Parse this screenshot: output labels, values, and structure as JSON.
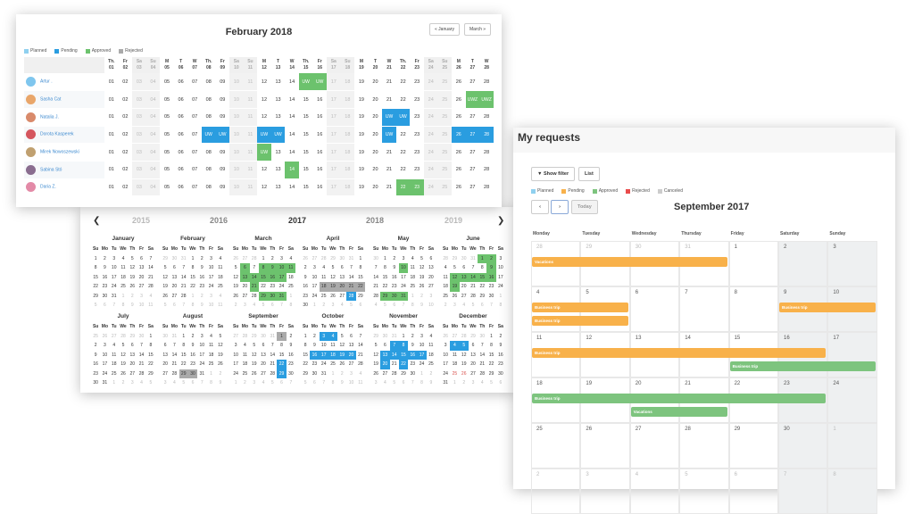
{
  "team": {
    "title": "February 2018",
    "prev": "« January",
    "next": "March »",
    "legend": [
      {
        "label": "Planned",
        "color": "#8fd0ef"
      },
      {
        "label": "Pending",
        "color": "#2a9de0"
      },
      {
        "label": "Approved",
        "color": "#6cc26d"
      },
      {
        "label": "Rejected",
        "color": "#aaaaaa"
      }
    ],
    "days": [
      {
        "d": "Th.",
        "n": "01"
      },
      {
        "d": "Fr",
        "n": "02"
      },
      {
        "d": "Sa",
        "n": "03"
      },
      {
        "d": "Su",
        "n": "04"
      },
      {
        "d": "M",
        "n": "05"
      },
      {
        "d": "T",
        "n": "06"
      },
      {
        "d": "W",
        "n": "07"
      },
      {
        "d": "Th.",
        "n": "08"
      },
      {
        "d": "Fr",
        "n": "09"
      },
      {
        "d": "Sa",
        "n": "10"
      },
      {
        "d": "Su",
        "n": "11"
      },
      {
        "d": "M",
        "n": "12"
      },
      {
        "d": "T",
        "n": "13"
      },
      {
        "d": "W",
        "n": "14"
      },
      {
        "d": "Th.",
        "n": "15"
      },
      {
        "d": "Fr",
        "n": "16"
      },
      {
        "d": "Sa",
        "n": "17"
      },
      {
        "d": "Su",
        "n": "18"
      },
      {
        "d": "M",
        "n": "19"
      },
      {
        "d": "T",
        "n": "20"
      },
      {
        "d": "W",
        "n": "21"
      },
      {
        "d": "Th.",
        "n": "22"
      },
      {
        "d": "Fr",
        "n": "23"
      },
      {
        "d": "Sa",
        "n": "24"
      },
      {
        "d": "Su",
        "n": "25"
      },
      {
        "d": "M",
        "n": "26"
      },
      {
        "d": "T",
        "n": "27"
      },
      {
        "d": "W",
        "n": "28"
      }
    ],
    "employees": [
      {
        "name": "Artur .",
        "avatar": "#7fc6ee",
        "marks": {
          "15": "UW",
          "16": "UW"
        },
        "status": "appr"
      },
      {
        "name": "Sasha Cat",
        "avatar": "#e9a66a",
        "marks": {
          "27": "UWZ",
          "28": "UWZ"
        },
        "status": "appr"
      },
      {
        "name": "Natalia J.",
        "avatar": "#d98a6b",
        "marks": {
          "21": "UW",
          "22": "UW"
        },
        "status": "pend"
      },
      {
        "name": "Dorota Kasperek",
        "avatar": "#d5565e",
        "marks": {
          "08": "UW",
          "09": "UW",
          "12": "UW",
          "13": "UW",
          "21": "UW",
          "26": "26",
          "27": "27",
          "28": "28"
        },
        "status": "pend"
      },
      {
        "name": "Mirek Nowoszewski",
        "avatar": "#c0a070",
        "marks": {
          "12": "UW"
        },
        "status": "appr"
      },
      {
        "name": "Sabina Stó",
        "avatar": "#8a6d8f",
        "marks": {
          "14": "14"
        },
        "status": "appr"
      },
      {
        "name": "Daria Z.",
        "avatar": "#e38aa7",
        "marks": {
          "22": "22",
          "23": "23"
        },
        "status": "appr"
      }
    ]
  },
  "year": {
    "years": [
      "2015",
      "2016",
      "2017",
      "2018",
      "2019"
    ],
    "current": "2017",
    "dow": [
      "Su",
      "Mo",
      "Tu",
      "We",
      "Th",
      "Fr",
      "Sa"
    ],
    "months": [
      {
        "name": "January",
        "first": 0,
        "days": 31,
        "prevdays": 31,
        "marks": {}
      },
      {
        "name": "February",
        "first": 3,
        "days": 28,
        "prevdays": 31,
        "marks": {}
      },
      {
        "name": "March",
        "first": 3,
        "days": 31,
        "prevdays": 28,
        "marks": {
          "6": "g",
          "8": "g",
          "9": "g",
          "10": "g",
          "11": "g",
          "13": "g",
          "14": "g",
          "15": "g",
          "16": "g",
          "17": "g",
          "21": "g",
          "29": "g",
          "30": "g",
          "31": "g"
        }
      },
      {
        "name": "April",
        "first": 6,
        "days": 30,
        "prevdays": 31,
        "marks": {
          "18": "gr",
          "19": "gr",
          "20": "gr",
          "21": "gr",
          "22": "gr",
          "28": "b"
        }
      },
      {
        "name": "May",
        "first": 1,
        "days": 31,
        "prevdays": 30,
        "marks": {
          "10": "g",
          "29": "g",
          "30": "g",
          "31": "g"
        }
      },
      {
        "name": "June",
        "first": 4,
        "days": 30,
        "prevdays": 31,
        "marks": {
          "1": "g",
          "2": "g",
          "9": "g",
          "12": "g",
          "13": "g",
          "14": "g",
          "15": "g",
          "16": "g",
          "19": "g"
        }
      },
      {
        "name": "July",
        "first": 6,
        "days": 31,
        "prevdays": 30,
        "marks": {}
      },
      {
        "name": "August",
        "first": 2,
        "days": 31,
        "prevdays": 31,
        "marks": {
          "29": "gr",
          "30": "gr"
        }
      },
      {
        "name": "September",
        "first": 5,
        "days": 30,
        "prevdays": 31,
        "marks": {
          "1": "gr",
          "22": "b",
          "29": "b"
        }
      },
      {
        "name": "October",
        "first": 0,
        "days": 31,
        "prevdays": 30,
        "marks": {
          "3": "b",
          "4": "b",
          "16": "b",
          "17": "b",
          "18": "b",
          "19": "b",
          "20": "b"
        }
      },
      {
        "name": "November",
        "first": 3,
        "days": 30,
        "prevdays": 31,
        "marks": {
          "7": "b",
          "8": "b",
          "13": "b",
          "14": "b",
          "15": "b",
          "16": "b",
          "17": "b",
          "20": "b",
          "22": "b"
        }
      },
      {
        "name": "December",
        "first": 5,
        "days": 31,
        "prevdays": 30,
        "marks": {
          "4": "b",
          "5": "b",
          "25": "r",
          "26": "r"
        }
      }
    ]
  },
  "requests": {
    "title": "My requests",
    "show_filter": "Show filter",
    "list": "List",
    "prev_icon": "‹",
    "next_icon": "›",
    "today": "Today",
    "month_title": "September 2017",
    "legend": [
      {
        "label": "Planned",
        "color": "#8fd0ef"
      },
      {
        "label": "Pending",
        "color": "#f8b14a"
      },
      {
        "label": "Approved",
        "color": "#7dc47e"
      },
      {
        "label": "Rejected",
        "color": "#e94b4b"
      },
      {
        "label": "Canceled",
        "color": "#cccccc"
      }
    ],
    "dow": [
      "Monday",
      "Tuesday",
      "Wednesday",
      "Thursday",
      "Friday",
      "Saturday",
      "Sunday"
    ],
    "weeks": [
      [
        "28",
        "29",
        "30",
        "31",
        "1",
        "2",
        "3"
      ],
      [
        "4",
        "5",
        "6",
        "7",
        "8",
        "9",
        "10"
      ],
      [
        "11",
        "12",
        "13",
        "14",
        "15",
        "16",
        "17"
      ],
      [
        "18",
        "19",
        "20",
        "21",
        "22",
        "23",
        "24"
      ],
      [
        "25",
        "26",
        "27",
        "28",
        "29",
        "30",
        "1"
      ],
      [
        "2",
        "3",
        "4",
        "5",
        "6",
        "7",
        "8"
      ]
    ],
    "events": [
      {
        "label": "Vacations",
        "week": 0,
        "start": 0,
        "span": 4,
        "slot": 0,
        "status": "o"
      },
      {
        "label": "Business trip",
        "week": 1,
        "start": 0,
        "span": 2,
        "slot": 0,
        "status": "o"
      },
      {
        "label": "Business trip",
        "week": 1,
        "start": 0,
        "span": 2,
        "slot": 1,
        "status": "o"
      },
      {
        "label": "Business trip",
        "week": 1,
        "start": 5,
        "span": 2,
        "slot": 0,
        "status": "o"
      },
      {
        "label": "Business trip",
        "week": 2,
        "start": 0,
        "span": 6,
        "slot": 0,
        "status": "o"
      },
      {
        "label": "Business trip",
        "week": 2,
        "start": 4,
        "span": 3,
        "slot": 1,
        "status": "g"
      },
      {
        "label": "Business trip",
        "week": 3,
        "start": 0,
        "span": 6,
        "slot": 0,
        "status": "g"
      },
      {
        "label": "Vacations",
        "week": 3,
        "start": 2,
        "span": 2,
        "slot": 1,
        "status": "g"
      }
    ]
  }
}
